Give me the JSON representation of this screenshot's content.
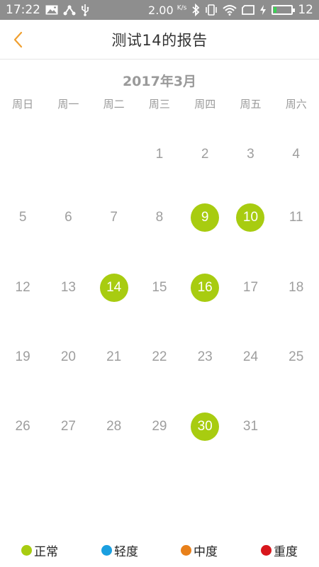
{
  "status_bar": {
    "time": "17:22",
    "speed": "2.00",
    "speed_unit": "K/s",
    "battery_level": "12",
    "icons": [
      "image-notification-icon",
      "share-icon",
      "usb-icon",
      "bluetooth-icon",
      "vibrate-icon",
      "wifi-icon",
      "sim-icon",
      "charging-icon",
      "battery-icon"
    ]
  },
  "header": {
    "title": "测试14的报告",
    "back_icon": "chevron-left-icon",
    "accent": "#f0a030"
  },
  "calendar": {
    "month_title": "2017年3月",
    "weekdays": [
      "周日",
      "周一",
      "周二",
      "周三",
      "周四",
      "周五",
      "周六"
    ],
    "weeks": [
      [
        "",
        "",
        "",
        "1",
        "2",
        "3",
        "4"
      ],
      [
        "5",
        "6",
        "7",
        "8",
        "9",
        "10",
        "11"
      ],
      [
        "12",
        "13",
        "14",
        "15",
        "16",
        "17",
        "18"
      ],
      [
        "19",
        "20",
        "21",
        "22",
        "23",
        "24",
        "25"
      ],
      [
        "26",
        "27",
        "28",
        "29",
        "30",
        "31",
        ""
      ]
    ],
    "marked_days": {
      "9": "正常",
      "10": "正常",
      "14": "正常",
      "16": "正常",
      "30": "正常"
    }
  },
  "legend": [
    {
      "label": "正常",
      "color": "#a8cc10"
    },
    {
      "label": "轻度",
      "color": "#1a9fe0"
    },
    {
      "label": "中度",
      "color": "#e8801a"
    },
    {
      "label": "重度",
      "color": "#d8161c"
    }
  ]
}
